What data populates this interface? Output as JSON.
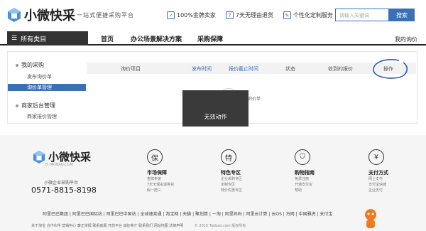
{
  "header": {
    "logo_text": "小微快采",
    "slogan": "一站式便捷采购平台",
    "promos": [
      {
        "icon": "shield-icon",
        "glyph": "✓",
        "label": "100%金牌卖家"
      },
      {
        "icon": "return-icon",
        "glyph": "7",
        "label": "7天无理由退货"
      },
      {
        "icon": "custom-icon",
        "glyph": "✎",
        "label": "个性化定制服务"
      }
    ],
    "search_placeholder": "请输入关键词",
    "search_button": "搜索"
  },
  "nav": {
    "all_categories": "所有类目",
    "items": [
      "首页",
      "办公场景解决方案",
      "采购保障"
    ],
    "my_quote": "我的询价"
  },
  "sidebar": {
    "group1": "我的采购",
    "group1_items": [
      "发布询价单",
      "询价单管理"
    ],
    "group2": "商家后台管理",
    "group2_items": [
      "商家报价管理"
    ]
  },
  "table": {
    "headers": [
      "询价项目",
      "发布时间",
      "报价截止时间",
      "状态",
      "收到的报价",
      "操作"
    ],
    "empty_text": "暂无询价单"
  },
  "toast": "无效动作",
  "footer": {
    "logo_text": "小微快采",
    "logo_sub": "B.TAOBAO.COM",
    "brand_line": "小微企业采购平台",
    "phone": "0571-8815-8198",
    "services": [
      {
        "glyph": "保",
        "icon": "guarantee-icon",
        "title": "市场保障",
        "lines": [
          "金牌卖家",
          "7天无理由退换货",
          "假一赔三"
        ]
      },
      {
        "glyph": "特",
        "icon": "special-icon",
        "title": "特色专区",
        "lines": [
          "企业采购专区",
          "定制专区",
          "特价优惠专区"
        ]
      },
      {
        "glyph": "⛉",
        "icon": "bag-icon",
        "title": "购物指南",
        "lines": [
          "免费注册",
          "开通支付宝",
          "帮助"
        ]
      },
      {
        "glyph": "¥",
        "icon": "yen-icon",
        "title": "支付方式",
        "lines": [
          "网上支付",
          "支付宝快捷",
          "企业支付"
        ]
      }
    ],
    "links": "阿里巴巴集团 | 阿里巴巴国际站 | 阿里巴巴中国站 | 全球速卖通 | 淘宝网 | 天猫 | 聚划算 | 一淘 | 阿里妈妈 | 阿里云计算 | 云OS | 万网 | 中国雅虎 | 支付宝",
    "links2": "关于淘宝  合作伙伴  营销中心  廉正举报  联系客服  开放平台  诚征英才  联系我们  网站地图  法律声明",
    "copyright": "© 2015 Taobao.com 版权所有"
  }
}
